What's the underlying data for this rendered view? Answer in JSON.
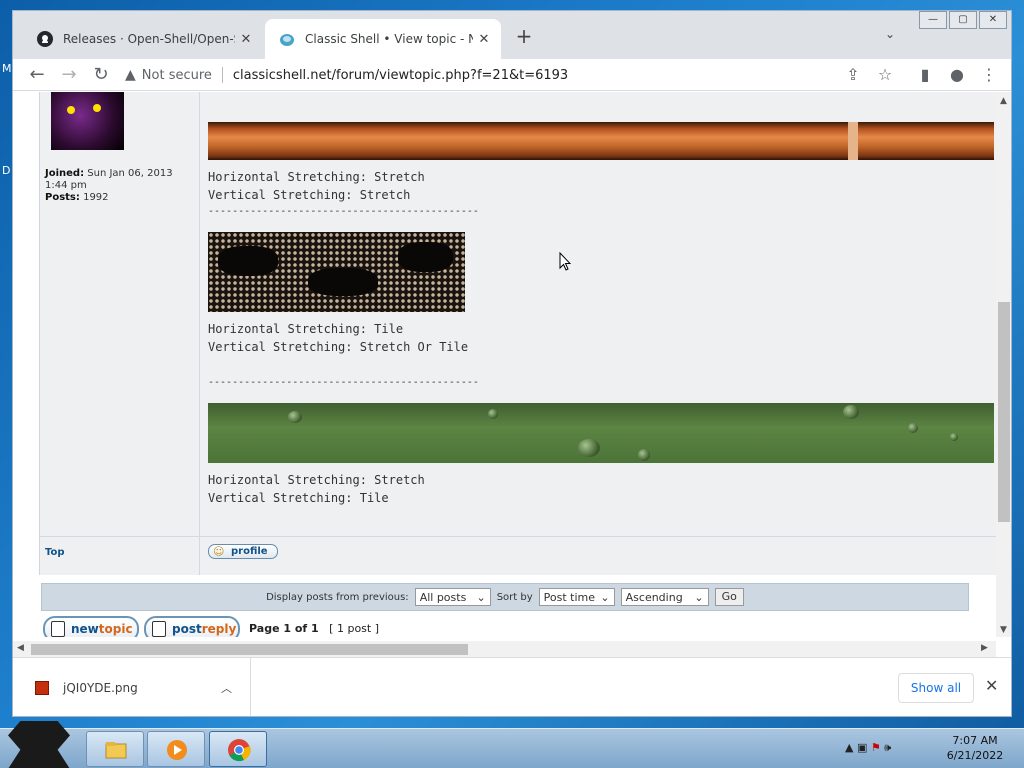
{
  "browser": {
    "tabs": [
      {
        "label": "Releases · Open-Shell/Open-Shell"
      },
      {
        "label": "Classic Shell • View topic - Nature"
      }
    ],
    "new_tab_icon": "plus-icon",
    "security_label": "Not secure",
    "url": "classicshell.net/forum/viewtopic.php?f=21&t=6193"
  },
  "desktop": {
    "letters": [
      "M",
      "D"
    ]
  },
  "post": {
    "author": {
      "joined_label": "Joined:",
      "joined_value": "Sun Jan 06, 2013 1:44 pm",
      "posts_label": "Posts:",
      "posts_value": "1992"
    },
    "lines": {
      "h1": "Horizontal Stretching: Stretch",
      "v1": "Vertical Stretching: Stretch",
      "sep1": "---------------------------------------------",
      "h2": "Horizontal Stretching: Tile",
      "v2": "Vertical Stretching: Stretch Or Tile",
      "sep2": "---------------------------------------------",
      "h3": "Horizontal Stretching: Stretch",
      "v3": "Vertical Stretching: Tile"
    },
    "top_link": "Top",
    "profile_label": "profile"
  },
  "display_bar": {
    "label": "Display posts from previous:",
    "posts_select": "All posts",
    "sort_label": "Sort by",
    "sort_select": "Post time",
    "order_select": "Ascending",
    "go_label": "Go"
  },
  "actions": {
    "newtopic_a": "new",
    "newtopic_b": "topic",
    "postreply_a": "post",
    "postreply_b": "reply",
    "page_info": "Page 1 of 1",
    "post_count": "[ 1 post ]"
  },
  "downloads": {
    "file_name": "jQI0YDE.png",
    "show_all": "Show all"
  },
  "taskbar": {
    "time": "7:07 AM",
    "date": "6/21/2022"
  }
}
